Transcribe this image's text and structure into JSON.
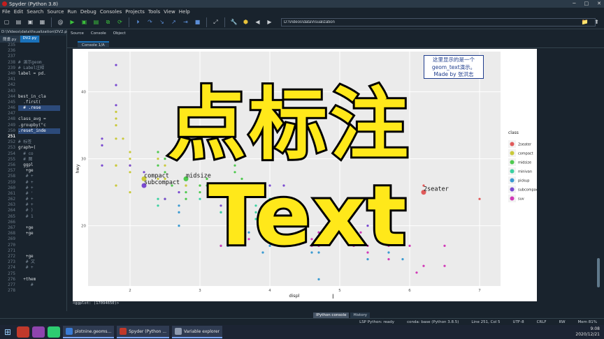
{
  "window": {
    "title": "Spyder (Python 3.8)"
  },
  "menu": [
    "File",
    "Edit",
    "Search",
    "Source",
    "Run",
    "Debug",
    "Consoles",
    "Projects",
    "Tools",
    "View",
    "Help"
  ],
  "toolbar": {
    "path": "D:\\Videos\\dataVisualization"
  },
  "editor": {
    "path": "D:\\Videos\\dataVisualization\\DV2.py",
    "tabs": [
      "簡畫.py",
      "DV2.py"
    ],
    "lines": [
      {
        "n": "235",
        "code": ""
      },
      {
        "n": "236",
        "code": ""
      },
      {
        "n": "237",
        "code": ""
      },
      {
        "n": "238",
        "code": "# 演示geom_"
      },
      {
        "n": "239",
        "code": "# Label注释"
      },
      {
        "n": "240",
        "code": "label = pd."
      },
      {
        "n": "241",
        "code": ""
      },
      {
        "n": "242",
        "code": ""
      },
      {
        "n": "243",
        "code": ""
      },
      {
        "n": "244",
        "code": "best_in_cla"
      },
      {
        "n": "245",
        "code": "  .first("
      },
      {
        "n": "246",
        "code": "  # .rese"
      },
      {
        "n": "247",
        "code": ""
      },
      {
        "n": "248",
        "code": "class_avg ="
      },
      {
        "n": "249",
        "code": ".groupby(\"c"
      },
      {
        "n": "250",
        "code": ".reset_inde"
      },
      {
        "n": "251",
        "code": ""
      },
      {
        "n": "252",
        "code": "# 标签"
      },
      {
        "n": "253",
        "code": "graph=("
      },
      {
        "n": "254",
        "code": "  # co"
      },
      {
        "n": "255",
        "code": "  # 图"
      },
      {
        "n": "256",
        "code": "  ggpl"
      },
      {
        "n": "257",
        "code": "   +ge"
      },
      {
        "n": "258",
        "code": "   # +"
      },
      {
        "n": "259",
        "code": "   # +"
      },
      {
        "n": "260",
        "code": "   # +"
      },
      {
        "n": "261",
        "code": "   # '"
      },
      {
        "n": "262",
        "code": "   # +"
      },
      {
        "n": "263",
        "code": "   # +"
      },
      {
        "n": "264",
        "code": "   # )"
      },
      {
        "n": "265",
        "code": "   # 1"
      },
      {
        "n": "266",
        "code": ""
      },
      {
        "n": "267",
        "code": "   +ge"
      },
      {
        "n": "268",
        "code": "   +ge"
      },
      {
        "n": "269",
        "code": ""
      },
      {
        "n": "270",
        "code": ""
      },
      {
        "n": "271",
        "code": ""
      },
      {
        "n": "272",
        "code": "   +ge"
      },
      {
        "n": "273",
        "code": "   # 文"
      },
      {
        "n": "274",
        "code": "   # +"
      },
      {
        "n": "275",
        "code": ""
      },
      {
        "n": "276",
        "code": "  +them"
      },
      {
        "n": "277",
        "code": "     #"
      },
      {
        "n": "278",
        "code": ""
      }
    ]
  },
  "right_tabs": [
    "Source",
    "Console",
    "Object"
  ],
  "console": {
    "tab_label": "Console 1/A",
    "output_line": "<ggplot: (17094650)>",
    "bottom_tabs": [
      "IPython console",
      "History"
    ]
  },
  "status": {
    "lsp": "LSP Python: ready",
    "conda": "conda: base (Python 3.8.5)",
    "position": "Line 251, Col 5",
    "encoding": "UTF-8",
    "eol": "CRLF",
    "rw": "RW",
    "mem": "Mem 81%"
  },
  "taskbar": {
    "items": [
      "plotnine.geoms...",
      "Spyder (Python ...",
      "Variable explorer"
    ],
    "time": "9:08",
    "date": "2020/12/21"
  },
  "overlay": {
    "line1": "点标注",
    "line2": "Text"
  },
  "annotation": {
    "text1": "这里显示的是一个",
    "text2": "geom_text演示。",
    "text3": "Made by 张洪志"
  },
  "chart_data": {
    "type": "scatter",
    "xlabel": "displ",
    "ylabel": "hwy",
    "xlim": [
      1.4,
      7.3
    ],
    "ylim": [
      11,
      46
    ],
    "xticks": [
      2,
      3,
      4,
      5,
      6,
      7
    ],
    "yticks": [
      20,
      30,
      40
    ],
    "legend": {
      "title": "class",
      "placement": "right",
      "entries": [
        {
          "name": "2seater",
          "color": "#e05a5a"
        },
        {
          "name": "compact",
          "color": "#c9c93a"
        },
        {
          "name": "midsize",
          "color": "#4ec94e"
        },
        {
          "name": "minivan",
          "color": "#3ad1a0"
        },
        {
          "name": "pickup",
          "color": "#3a9ad1"
        },
        {
          "name": "subcompact",
          "color": "#7a4ad1"
        },
        {
          "name": "suv",
          "color": "#d13ab7"
        }
      ]
    },
    "labels": [
      {
        "text": "compact",
        "x": 2.2,
        "y": 27.0,
        "color": "#c9c93a"
      },
      {
        "text": "subcompact",
        "x": 2.2,
        "y": 26.0,
        "color": "#7a4ad1"
      },
      {
        "text": "midsize",
        "x": 2.8,
        "y": 27.0,
        "color": "#4ec94e"
      },
      {
        "text": "2seater",
        "x": 6.2,
        "y": 25.0,
        "color": "#e05a5a"
      }
    ],
    "series": [
      {
        "name": "compact",
        "color": "#c9c93a",
        "points": [
          [
            1.8,
            29
          ],
          [
            1.8,
            29
          ],
          [
            2.0,
            31
          ],
          [
            2.0,
            30
          ],
          [
            2.8,
            26
          ],
          [
            2.8,
            26
          ],
          [
            3.1,
            27
          ],
          [
            1.8,
            26
          ],
          [
            2.0,
            25
          ],
          [
            2.0,
            28
          ],
          [
            2.4,
            27
          ],
          [
            2.4,
            30
          ],
          [
            2.2,
            26
          ],
          [
            2.2,
            27
          ],
          [
            2.5,
            27
          ],
          [
            3.0,
            26
          ],
          [
            1.8,
            36
          ],
          [
            1.8,
            35
          ],
          [
            1.8,
            37
          ],
          [
            1.8,
            33
          ],
          [
            2.0,
            29
          ],
          [
            1.9,
            33
          ],
          [
            2.5,
            29
          ],
          [
            2.6,
            31
          ]
        ]
      },
      {
        "name": "midsize",
        "color": "#4ec94e",
        "points": [
          [
            2.4,
            29
          ],
          [
            3.1,
            27
          ],
          [
            2.5,
            28
          ],
          [
            3.3,
            26
          ],
          [
            3.5,
            28
          ],
          [
            3.6,
            27
          ],
          [
            3.1,
            26
          ],
          [
            2.8,
            25
          ],
          [
            2.5,
            24
          ],
          [
            3.0,
            25
          ],
          [
            3.0,
            26
          ],
          [
            3.5,
            29
          ],
          [
            2.4,
            31
          ],
          [
            2.6,
            26
          ],
          [
            3.8,
            26
          ],
          [
            2.5,
            30
          ],
          [
            2.8,
            24
          ],
          [
            2.7,
            31
          ]
        ]
      },
      {
        "name": "minivan",
        "color": "#3ad1a0",
        "points": [
          [
            2.4,
            24
          ],
          [
            3.0,
            24
          ],
          [
            3.3,
            22
          ],
          [
            3.3,
            22
          ],
          [
            3.8,
            22
          ],
          [
            3.8,
            23
          ],
          [
            4.0,
            24
          ],
          [
            3.3,
            17
          ],
          [
            3.8,
            21
          ],
          [
            2.4,
            23
          ]
        ]
      },
      {
        "name": "subcompact",
        "color": "#7a4ad1",
        "points": [
          [
            1.6,
            33
          ],
          [
            1.6,
            32
          ],
          [
            1.6,
            29
          ],
          [
            1.8,
            44
          ],
          [
            1.8,
            41
          ],
          [
            1.8,
            38
          ],
          [
            2.0,
            29
          ],
          [
            2.2,
            26
          ],
          [
            2.5,
            24
          ],
          [
            2.7,
            25
          ],
          [
            3.8,
            26
          ],
          [
            4.6,
            17
          ],
          [
            5.4,
            20
          ],
          [
            4.2,
            26
          ],
          [
            2.2,
            28
          ],
          [
            3.3,
            23
          ],
          [
            4.0,
            26
          ]
        ]
      },
      {
        "name": "pickup",
        "color": "#3a9ad1",
        "points": [
          [
            2.7,
            20
          ],
          [
            2.7,
            22
          ],
          [
            3.4,
            19
          ],
          [
            3.4,
            17
          ],
          [
            4.0,
            17
          ],
          [
            4.7,
            17
          ],
          [
            4.7,
            16
          ],
          [
            4.7,
            19
          ],
          [
            5.2,
            17
          ],
          [
            5.7,
            16
          ],
          [
            5.9,
            15
          ],
          [
            4.7,
            12
          ],
          [
            3.9,
            16
          ],
          [
            4.2,
            17
          ],
          [
            2.7,
            23
          ],
          [
            4.6,
            16
          ],
          [
            5.4,
            15
          ],
          [
            3.7,
            19
          ],
          [
            4.0,
            20
          ]
        ]
      },
      {
        "name": "suv",
        "color": "#d13ab7",
        "points": [
          [
            5.3,
            19
          ],
          [
            5.3,
            18
          ],
          [
            5.7,
            15
          ],
          [
            6.0,
            17
          ],
          [
            5.7,
            17
          ],
          [
            6.5,
            14
          ],
          [
            4.7,
            18
          ],
          [
            4.7,
            19
          ],
          [
            5.2,
            17
          ],
          [
            4.0,
            19
          ],
          [
            4.6,
            17
          ],
          [
            5.4,
            17
          ],
          [
            3.7,
            18
          ],
          [
            4.6,
            18
          ],
          [
            5.4,
            16
          ],
          [
            6.1,
            13
          ],
          [
            4.7,
            17
          ],
          [
            5.0,
            20
          ],
          [
            4.2,
            21
          ],
          [
            3.4,
            18
          ],
          [
            3.3,
            17
          ],
          [
            4.0,
            18
          ],
          [
            6.2,
            14
          ],
          [
            6.5,
            17
          ]
        ]
      },
      {
        "name": "2seater",
        "color": "#e05a5a",
        "points": [
          [
            5.7,
            26
          ],
          [
            5.7,
            23
          ],
          [
            6.2,
            26
          ],
          [
            6.2,
            25
          ],
          [
            7.0,
            24
          ]
        ]
      }
    ]
  }
}
